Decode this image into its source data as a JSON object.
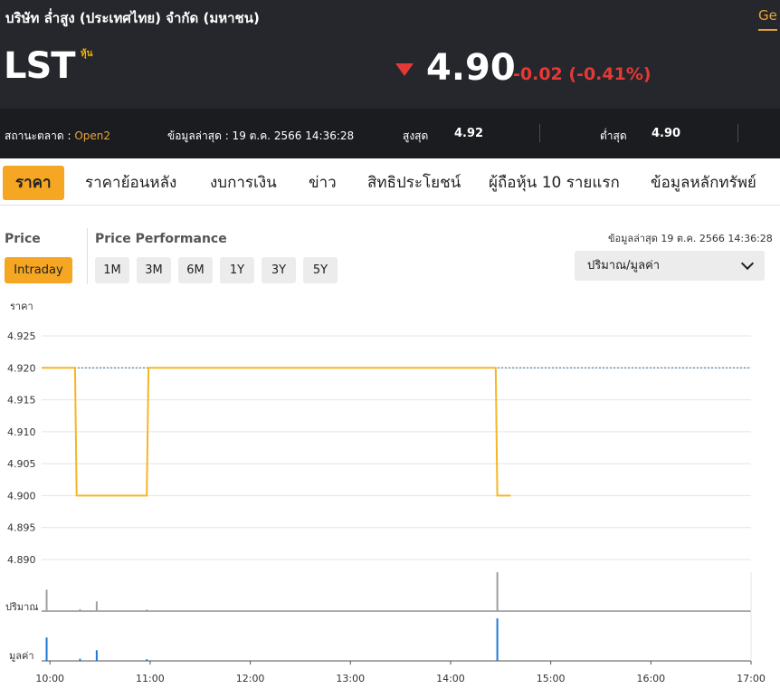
{
  "header": {
    "company_name": "บริษัท ล่ำสูง (ประเทศไทย) จำกัด (มหาชน)",
    "lang_link": "Ge",
    "symbol": "LST",
    "symbol_badge": "หุ้น",
    "last_price": "4.90",
    "change": "-0.02 (-0.41%)",
    "market_status_label": "สถานะตลาด :",
    "market_status_value": "Open2",
    "last_update_label": "ข้อมูลล่าสุด : 19 ต.ค. 2566 14:36:28",
    "high_label": "สูงสุด",
    "high_value": "4.92",
    "low_label": "ต่ำสุด",
    "low_value": "4.90"
  },
  "tabs": [
    {
      "label": "ราคา",
      "active": true
    },
    {
      "label": "ราคาย้อนหลัง",
      "active": false
    },
    {
      "label": "งบการเงิน",
      "active": false
    },
    {
      "label": "ข่าว",
      "active": false
    },
    {
      "label": "สิทธิประโยชน์",
      "active": false
    },
    {
      "label": "ผู้ถือหุ้น 10 รายแรก",
      "active": false
    },
    {
      "label": "ข้อมูลหลักทรัพย์",
      "active": false
    }
  ],
  "controls": {
    "price_label": "Price",
    "intraday_label": "Intraday",
    "performance_label": "Price Performance",
    "periods": [
      "1M",
      "3M",
      "6M",
      "1Y",
      "3Y",
      "5Y"
    ],
    "timestamp": "ข้อมูลล่าสุด 19 ต.ค. 2566 14:36:28",
    "dropdown_value": "ปริมาณ/มูลค่า"
  },
  "colors": {
    "accent": "#f5a623",
    "down": "#e53935",
    "price_line": "#f5b625",
    "volume_bar": "#9e9e9e",
    "value_bar": "#1e78d4"
  },
  "chart_data": {
    "type": "line",
    "ylabel": "ราคา",
    "ylim": [
      4.89,
      4.925
    ],
    "yticks": [
      "4.925",
      "4.920",
      "4.915",
      "4.910",
      "4.905",
      "4.900",
      "4.895",
      "4.890"
    ],
    "x_ticks": [
      "10:00",
      "11:00",
      "12:00",
      "13:00",
      "14:00",
      "15:00",
      "16:00",
      "17:00"
    ],
    "reference_line": 4.92,
    "price_series": [
      {
        "t": "9:55",
        "y": 4.92
      },
      {
        "t": "10:15",
        "y": 4.92
      },
      {
        "t": "10:16",
        "y": 4.9
      },
      {
        "t": "10:58",
        "y": 4.9
      },
      {
        "t": "10:59",
        "y": 4.92
      },
      {
        "t": "14:27",
        "y": 4.92
      },
      {
        "t": "14:28",
        "y": 4.9
      },
      {
        "t": "14:36",
        "y": 4.9
      }
    ],
    "volume_label": "ปริมาณ",
    "volume_bars": [
      {
        "t": "9:58",
        "v": 0.55
      },
      {
        "t": "10:18",
        "v": 0.05
      },
      {
        "t": "10:28",
        "v": 0.25
      },
      {
        "t": "10:58",
        "v": 0.04
      },
      {
        "t": "14:28",
        "v": 1.0
      }
    ],
    "value_label": "มูลค่า",
    "value_bars": [
      {
        "t": "9:58",
        "v": 0.55
      },
      {
        "t": "10:18",
        "v": 0.05
      },
      {
        "t": "10:28",
        "v": 0.25
      },
      {
        "t": "10:58",
        "v": 0.04
      },
      {
        "t": "14:28",
        "v": 1.0
      }
    ]
  }
}
